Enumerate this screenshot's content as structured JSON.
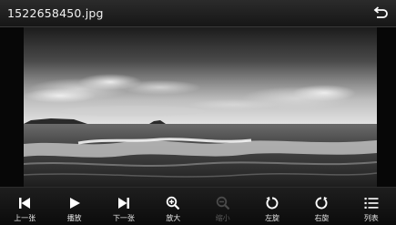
{
  "window": {
    "title": "1522658450.jpg"
  },
  "toolbar": {
    "items": [
      {
        "label": "上一张",
        "icon": "previous-icon",
        "enabled": true
      },
      {
        "label": "播放",
        "icon": "play-icon",
        "enabled": true
      },
      {
        "label": "下一张",
        "icon": "next-icon",
        "enabled": true
      },
      {
        "label": "放大",
        "icon": "zoom-in-icon",
        "enabled": true
      },
      {
        "label": "缩小",
        "icon": "zoom-out-icon",
        "enabled": false
      },
      {
        "label": "左旋",
        "icon": "rotate-left-icon",
        "enabled": true
      },
      {
        "label": "右旋",
        "icon": "rotate-right-icon",
        "enabled": true
      },
      {
        "label": "列表",
        "icon": "list-icon",
        "enabled": true
      }
    ]
  },
  "colors": {
    "titlebar": "#1f1f1f",
    "toolbar": "#151515",
    "disabled": "#5a5a5a"
  }
}
